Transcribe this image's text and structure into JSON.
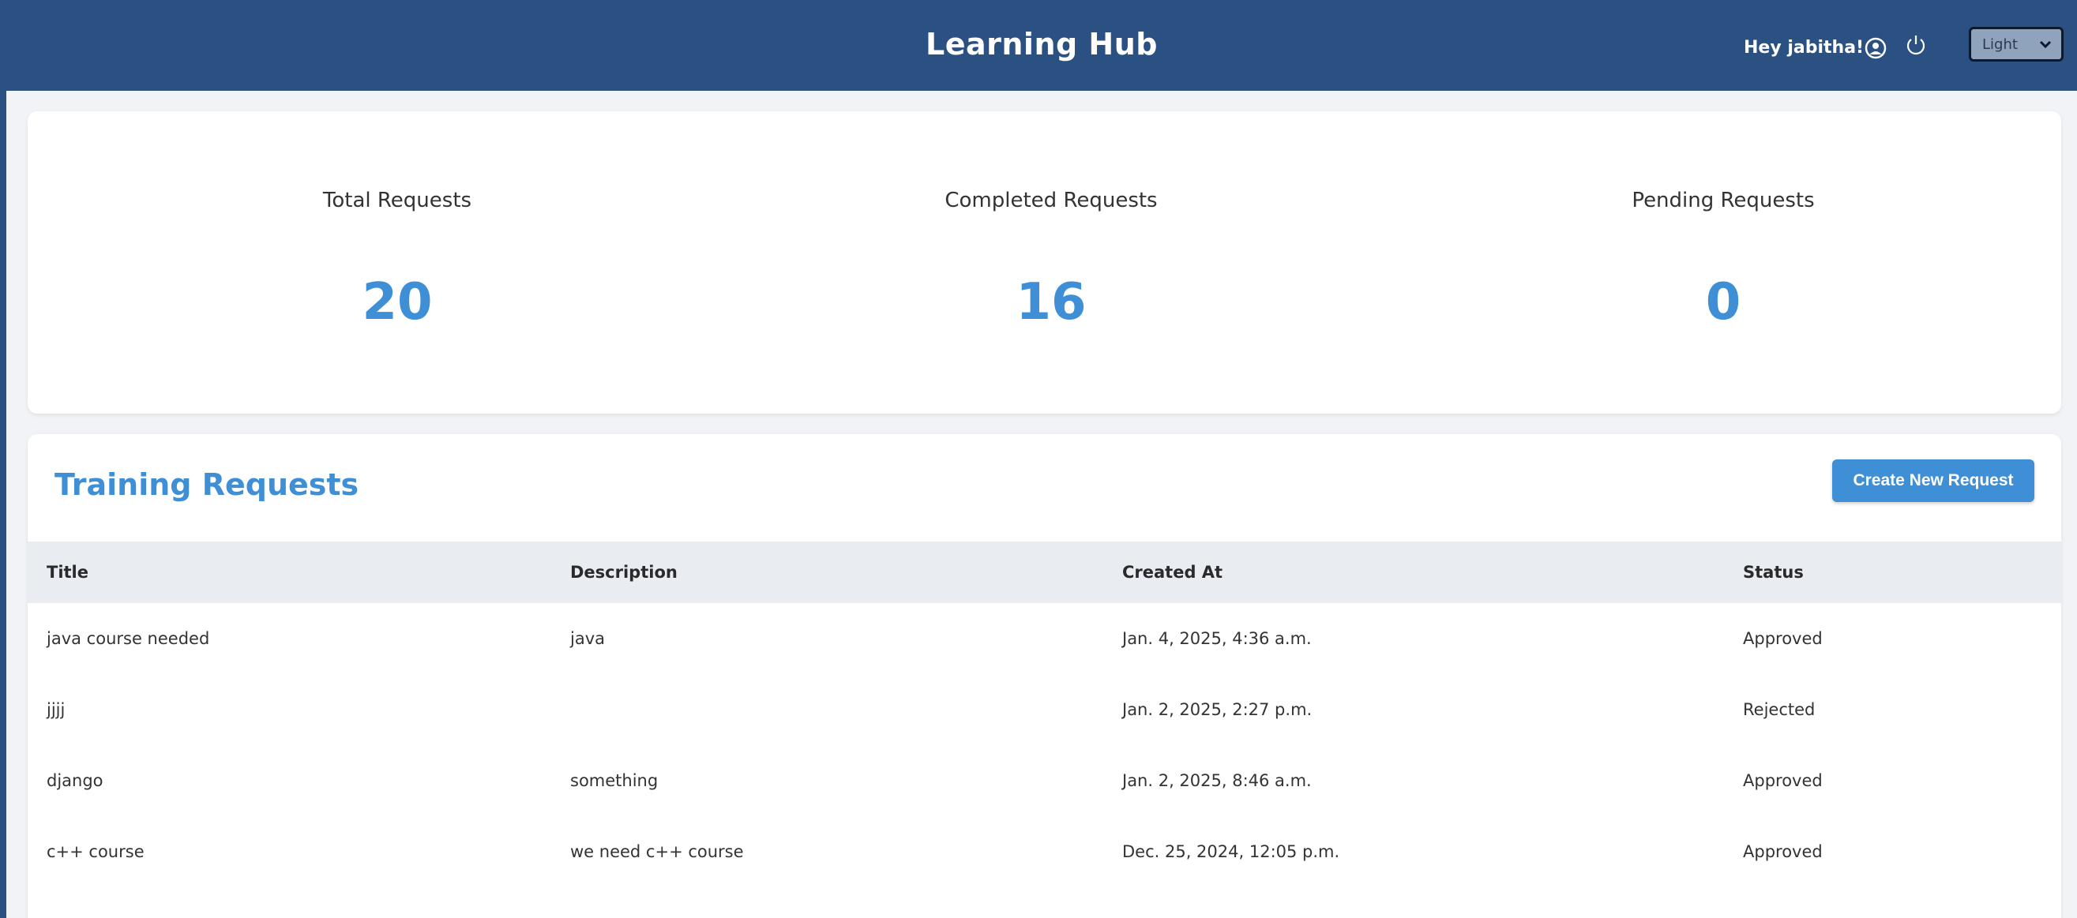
{
  "header": {
    "title": "Learning Hub",
    "greeting": "Hey jabitha!",
    "theme_select": "Light",
    "bg_color": "#2b5082"
  },
  "stats": [
    {
      "label": "Total Requests",
      "value": "20"
    },
    {
      "label": "Completed Requests",
      "value": "16"
    },
    {
      "label": "Pending Requests",
      "value": "0"
    }
  ],
  "requests": {
    "title": "Training Requests",
    "create_label": "Create New Request",
    "columns": [
      "Title",
      "Description",
      "Created At",
      "Status"
    ],
    "rows": [
      {
        "title": "java course needed",
        "description": "java",
        "created_at": "Jan. 4, 2025, 4:36 a.m.",
        "status": "Approved"
      },
      {
        "title": "jjjj",
        "description": "",
        "created_at": "Jan. 2, 2025, 2:27 p.m.",
        "status": "Rejected"
      },
      {
        "title": "django",
        "description": "something",
        "created_at": "Jan. 2, 2025, 8:46 a.m.",
        "status": "Approved"
      },
      {
        "title": "c++ course",
        "description": "we need c++ course",
        "created_at": "Dec. 25, 2024, 12:05 p.m.",
        "status": "Approved"
      }
    ]
  },
  "accent_color": "#3f8fd6"
}
